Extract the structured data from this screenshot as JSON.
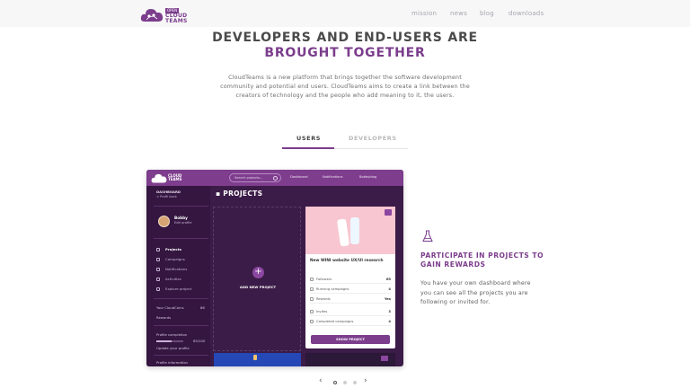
{
  "header": {
    "logo_badge": "OPEN",
    "logo_text_line1": "CLOUD",
    "logo_text_line2": "TEAMS",
    "nav": [
      "mission",
      "news",
      "blog",
      "downloads"
    ]
  },
  "hero": {
    "title_line1": "DEVELOPERS AND END-USERS ARE",
    "title_line2": "BROUGHT TOGETHER",
    "intro_line1": "CloudTeams is a new platform that brings together the software development",
    "intro_line2": "community and potential end users. CloudTeams aims to create a link between the",
    "intro_line3": "creators of technology and the people who add meaning to it, the users."
  },
  "tabs": {
    "users": "USERS",
    "developers": "DEVELOPERS",
    "active": "users"
  },
  "mockup": {
    "logo_line1": "CLOUD",
    "logo_line2": "TEAMS",
    "search_placeholder": "Search projects...",
    "top_links": [
      "Dashboard",
      "Notifications",
      "Bobbyblog"
    ],
    "sidebar": {
      "section": "DASHBOARD",
      "back": "< Profil back",
      "user_name": "Bobby",
      "edit_profile": "Edit profile",
      "menu": [
        "Projects",
        "Campaigns",
        "Notifications",
        "Activities",
        "Explore project"
      ],
      "coins_label": "Your CloudCoins",
      "coins_value": "86",
      "rewards": "Rewards",
      "profile_completion": "Profile completion",
      "completion_value": "65/100",
      "update_profile": "Update your profile",
      "profile_info": "Profile information",
      "information": "Information"
    },
    "main_title": "PROJECTS",
    "add_new_project": "ADD NEW PROJECT",
    "card": {
      "title": "New WINI website UX/UI research",
      "rows": [
        {
          "label": "Followers",
          "value": "65"
        },
        {
          "label": "Running campaigns",
          "value": "4"
        },
        {
          "label": "Rewards",
          "value": "Yes"
        },
        {
          "label": "Invites",
          "value": "3"
        },
        {
          "label": "Completed campaigns",
          "value": "4"
        }
      ],
      "button": "SHOW PROJECT"
    }
  },
  "feature": {
    "icon": "flask-icon",
    "title_line1": "PARTICIPATE IN PROJECTS TO",
    "title_line2": "GAIN REWARDS",
    "text_line1": "You have your own dashboard where",
    "text_line2": "you can see all the projects you are",
    "text_line3": "following or invited for."
  },
  "carousel": {
    "prev": "‹",
    "next": "›",
    "slide_count": 3,
    "active_index": 0
  },
  "colors": {
    "brand": "#7b3d8c",
    "mock_dark": "#3b1b47",
    "mock_topbar": "#7e3d8d"
  }
}
